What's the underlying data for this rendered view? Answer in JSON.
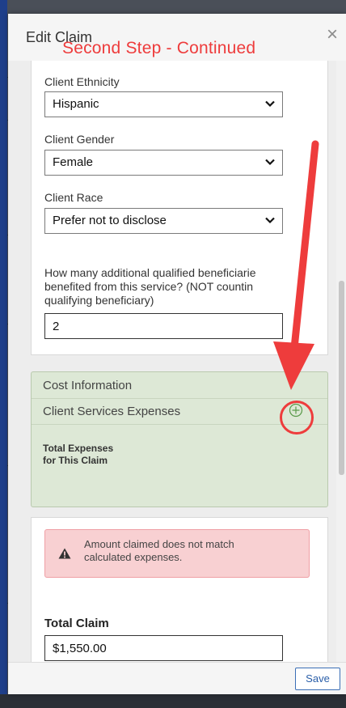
{
  "modal": {
    "title": "Edit Claim",
    "close_symbol": "×"
  },
  "annotation": {
    "text": "Second Step - Continued",
    "color": "#ee3c3c"
  },
  "client_details": {
    "ethnicity_label": "Client Ethnicity",
    "ethnicity_value": "Hispanic",
    "gender_label": "Client Gender",
    "gender_value": "Female",
    "race_label": "Client Race",
    "race_value": "Prefer not to disclose",
    "beneficiaries_question_lines": [
      "How many additional qualified beneficiarie",
      "benefited from this service? (NOT countin",
      "qualifying beneficiary)"
    ],
    "beneficiaries_value": "2"
  },
  "cost_information": {
    "heading": "Cost Information",
    "expenses_label": "Client Services Expenses",
    "add_icon": "plus-circle-icon",
    "total_expenses_lines": [
      "Total Expenses",
      "for This Claim"
    ],
    "panel_color": "#dde8d6"
  },
  "alert": {
    "icon": "warning-triangle-icon",
    "lines": [
      "Amount claimed does not match",
      "calculated expenses."
    ],
    "color": "#f8d0d2"
  },
  "total_claim": {
    "label": "Total Claim",
    "value": "$1,550.00"
  },
  "footer": {
    "save_label": "Save"
  }
}
